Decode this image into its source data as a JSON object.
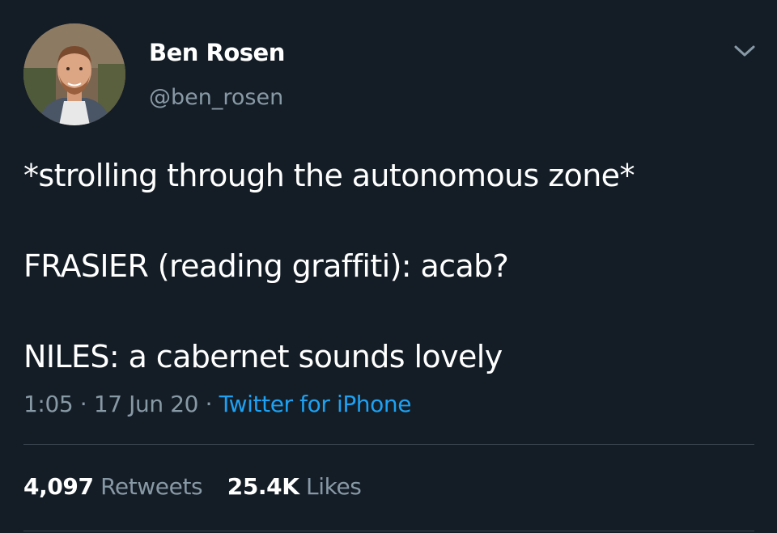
{
  "author": {
    "name": "Ben Rosen",
    "handle": "@ben_rosen"
  },
  "icons": {
    "avatar": "profile-photo",
    "menu": "chevron-down-icon"
  },
  "tweet": {
    "lines": [
      "*strolling through the autonomous zone*",
      "FRASIER (reading graffiti): acab?",
      "NILES: a cabernet sounds lovely"
    ],
    "time": "1:05",
    "date": "17 Jun 20",
    "separator": "·",
    "source": "Twitter for iPhone"
  },
  "stats": {
    "retweets_count": "4,097",
    "retweets_label": "Retweets",
    "likes_count": "25.4K",
    "likes_label": "Likes"
  },
  "colors": {
    "background": "#141d26",
    "text": "#ffffff",
    "secondary": "#8899a6",
    "link": "#1da1f2",
    "divider": "#38444d"
  }
}
